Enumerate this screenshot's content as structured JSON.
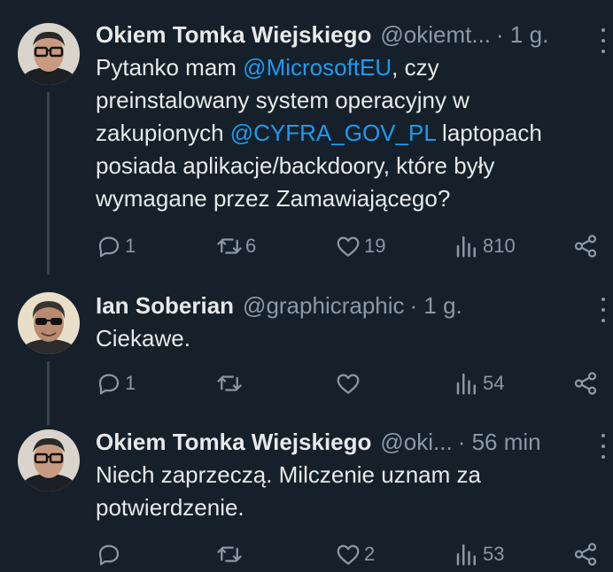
{
  "tweets": [
    {
      "name": "Okiem Tomka Wiejskiego",
      "handle": "@okiemt...",
      "time": "· 1 g.",
      "body_parts": [
        {
          "text": "Pytanko mam "
        },
        {
          "text": "@MicrosoftEU",
          "mention": true
        },
        {
          "text": ", czy preinstalowany system operacyjny w zakupionych "
        },
        {
          "text": "@CYFRA_GOV_PL",
          "mention": true
        },
        {
          "text": " laptopach posiada aplikacje/backdoory, które były wymagane przez Zamawiającego?"
        }
      ],
      "reply_count": "1",
      "retweet_count": "6",
      "like_count": "19",
      "views_count": "810"
    },
    {
      "name": "Ian Soberian",
      "handle": "@graphicraphic",
      "time": "· 1 g.",
      "body_parts": [
        {
          "text": "Ciekawe."
        }
      ],
      "reply_count": "1",
      "retweet_count": "",
      "like_count": "",
      "views_count": "54"
    },
    {
      "name": "Okiem Tomka Wiejskiego",
      "handle": "@oki...",
      "time": "· 56 min",
      "body_parts": [
        {
          "text": "Niech zaprzeczą. Milczenie uznam za potwierdzenie."
        }
      ],
      "reply_count": "",
      "retweet_count": "",
      "like_count": "2",
      "views_count": "53"
    }
  ],
  "colors": {
    "background": "#15202b",
    "text": "#e7e9ea",
    "secondary": "#8b98a5",
    "mention": "#1d9bf0",
    "thread_line": "#38444d"
  },
  "icons": [
    "reply-icon",
    "retweet-icon",
    "like-icon",
    "views-icon",
    "share-icon",
    "more-icon"
  ]
}
